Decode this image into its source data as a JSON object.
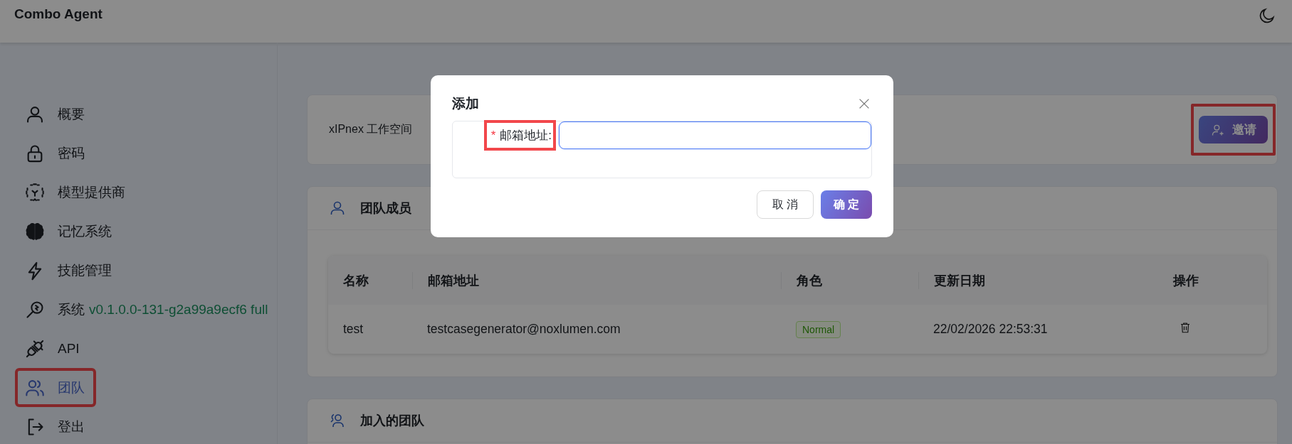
{
  "header": {
    "title": "Combo Agent"
  },
  "sidebar": {
    "items": [
      {
        "label": "概要",
        "selected": false,
        "highlighted": false
      },
      {
        "label": "密码",
        "selected": false,
        "highlighted": false
      },
      {
        "label": "模型提供商",
        "selected": false,
        "highlighted": false
      },
      {
        "label": "记忆系统",
        "selected": false,
        "highlighted": false
      },
      {
        "label": "技能管理",
        "selected": false,
        "highlighted": false
      },
      {
        "label": "系统",
        "version": "v0.1.0.0-131-g2a99a9ecf6 full",
        "selected": false,
        "highlighted": false
      },
      {
        "label": "API",
        "selected": false,
        "highlighted": false
      },
      {
        "label": "团队",
        "selected": true,
        "highlighted": true
      },
      {
        "label": "登出",
        "selected": false,
        "highlighted": false
      }
    ]
  },
  "workspace": {
    "name": "xIPnex 工作空间",
    "invite_button": {
      "label": "邀请",
      "highlighted": true
    }
  },
  "members": {
    "title": "团队成员",
    "table": {
      "columns": [
        "名称",
        "邮箱地址",
        "角色",
        "更新日期",
        "操作"
      ],
      "rows": [
        {
          "name": "test",
          "email": "testcasegenerator@noxlumen.com",
          "role": "Normal",
          "updated": "22/02/2026 22:53:31"
        }
      ]
    }
  },
  "joined": {
    "title": "加入的团队"
  },
  "modal": {
    "title": "添加",
    "fields": [
      {
        "required_mark": "*",
        "label": "邮箱地址:",
        "focused": true,
        "highlighted": true
      }
    ],
    "buttons": [
      {
        "label": "取 消",
        "kind": "default"
      },
      {
        "label": "确 定",
        "kind": "primary"
      }
    ]
  }
}
